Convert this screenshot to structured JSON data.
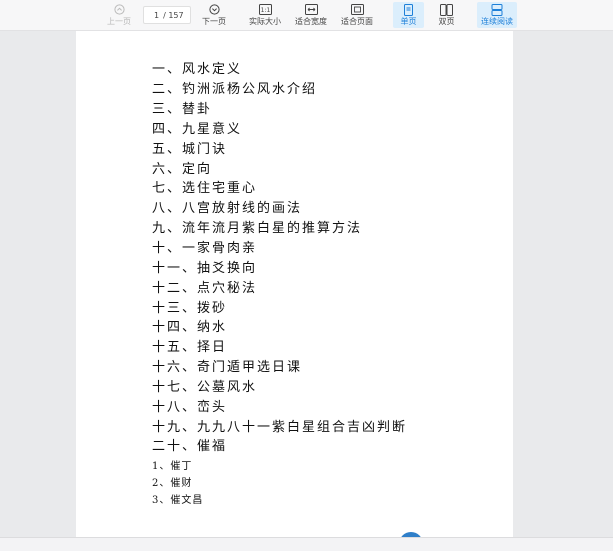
{
  "toolbar": {
    "prev_label": "上一页",
    "page_current": "1",
    "page_total": "/ 157",
    "next_label": "下一页",
    "actual_size_label": "实际大小",
    "fit_width_label": "适合宽度",
    "fit_page_label": "适合页面",
    "single_page_label": "单页",
    "double_page_label": "双页",
    "continuous_label": "连续阅读"
  },
  "document": {
    "toc": [
      "一、风水定义",
      "二、钓洲派杨公风水介绍",
      "三、替卦",
      "四、九星意义",
      "五、城门诀",
      "六、定向",
      "七、选住宅重心",
      "八、八宫放射线的画法",
      "九、流年流月紫白星的推算方法",
      "十、一家骨肉亲",
      "十一、抽爻换向",
      "十二、点穴秘法",
      "十三、拨砂",
      "十四、纳水",
      "十五、择日",
      "十六、奇门遁甲选日课",
      "十七、公墓风水",
      "十八、峦头",
      "十九、九九八十一紫白星组合吉凶判断",
      "二十、催福"
    ],
    "subitems": [
      "1、催丁",
      "2、催财",
      "3、催文昌"
    ]
  },
  "colors": {
    "toolbar_bg": "#f7f7f8",
    "active_tab_bg": "#dbeefc",
    "active_tab_fg": "#1d7fd8",
    "viewer_bg": "#e9eaec",
    "page_bg": "#ffffff"
  }
}
